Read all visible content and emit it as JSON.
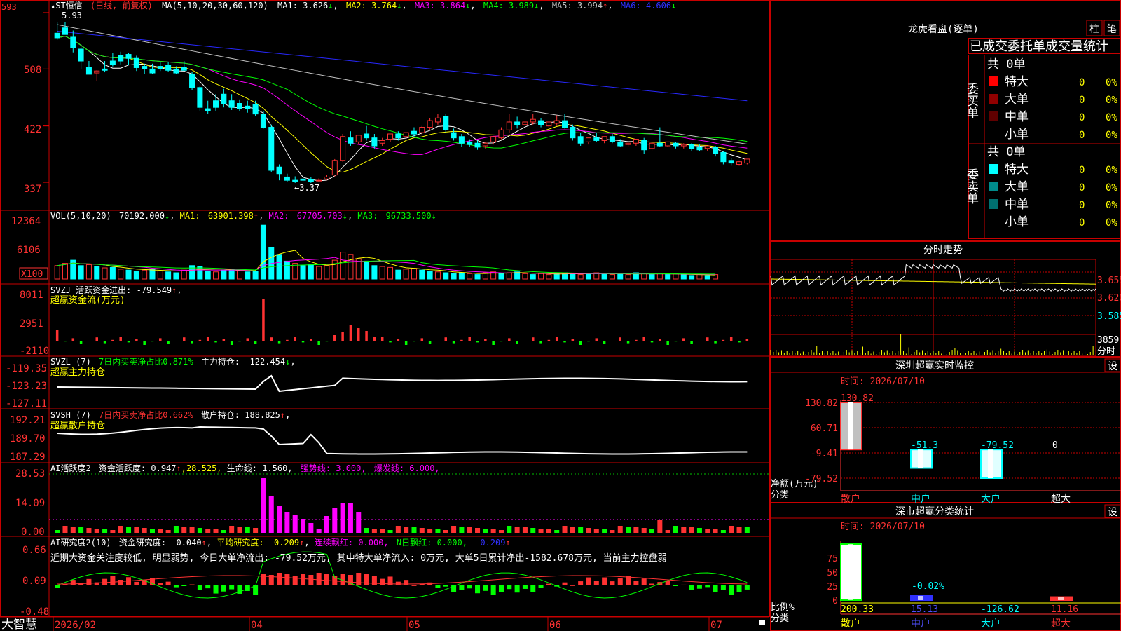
{
  "stock": {
    "name": "★ST恒信",
    "period": "(日线, 前复权)"
  },
  "colors": {
    "up": "#ff3232",
    "down": "#00ffff",
    "bg": "#000000",
    "border": "#ff0000",
    "ma5": "#ffffff",
    "ma10": "#ffff00",
    "ma20": "#ff00ff",
    "ma30": "#00ff00",
    "ma60": "#c0c0c0",
    "ma120": "#2828ff"
  },
  "price_panel": {
    "axis_labels": [
      "593",
      "508",
      "422",
      "337"
    ],
    "ma_legend": {
      "prefix": "MA(5,10,20,30,60,120)",
      "items": [
        {
          "label": "MA1: 3.626",
          "arrow": "↓"
        },
        {
          "label": "MA2: 3.764",
          "arrow": "↓"
        },
        {
          "label": "MA3: 3.864",
          "arrow": "↓"
        },
        {
          "label": "MA4: 3.989",
          "arrow": "↓"
        },
        {
          "label": "MA5: 3.994",
          "arrow": "↑"
        },
        {
          "label": "MA6: 4.606",
          "arrow": "↓"
        }
      ]
    },
    "high_marker": "5.93",
    "low_marker": "←3.37"
  },
  "vol_panel": {
    "axis_labels": [
      "12364",
      "6106",
      "X100"
    ],
    "legend": [
      {
        "label": "VOL(5,10,20)",
        "value": "70192.000",
        "arrow": "↓"
      },
      {
        "label": "MA1:",
        "value": "63901.398",
        "arrow": "↑"
      },
      {
        "label": "MA2:",
        "value": "67705.703",
        "arrow": "↓"
      },
      {
        "label": "MA3:",
        "value": "96733.500",
        "arrow": "↓"
      }
    ]
  },
  "svzj_panel": {
    "axis_labels": [
      "8011",
      "2951",
      "-2110"
    ],
    "line1": "SVZJ  活跃资金进出: -79.549",
    "line1_arrow": "↑",
    "line1_tail": ",",
    "line2": "超赢资金流(万元)"
  },
  "svzl_panel": {
    "axis_labels": [
      "-119.35",
      "-123.23",
      "-127.11"
    ],
    "name": "SVZL (7)",
    "ratio": "7日内买卖净占比0.871%",
    "hold": "主力持仓: -122.454",
    "hold_arrow": "↓",
    "tail": ",",
    "line2": "超赢主力持仓"
  },
  "svsh_panel": {
    "axis_labels": [
      "192.21",
      "189.70",
      "187.29"
    ],
    "name": "SVSH (7)",
    "ratio": "7日内买卖净占比0.662%",
    "hold": "散户持仓: 188.825",
    "hold_arrow": "↑",
    "tail": ",",
    "line2": "超赢散户持仓"
  },
  "ai1_panel": {
    "axis_labels": [
      "28.53",
      "14.09",
      "0.00"
    ],
    "name": "AI活跃度2",
    "v1": "资金活跃度: 0.947",
    "v1_arrow": "↑",
    "v2": ",28.525,",
    "v3": "生命线: 1.560,",
    "v4": "强势线: 3.000,",
    "v5": "爆发线: 6.000,"
  },
  "ai2_panel": {
    "axis_labels": [
      "0.66",
      "0.09",
      "-0.48"
    ],
    "name": "AI研究度2(10)",
    "v1": "资金研究度: -0.040",
    "v1_arrow": "↑",
    "v2": "平均研究度: -0.209",
    "v2_arrow": "↑",
    "v3": "连续飘红: 0.000,",
    "v4": "N日飘红: 0.000,",
    "v5": "-0.209",
    "v5_arrow": "↑",
    "comment": "近期大资金关注度较低, 明显弱势, 今日大单净流出: -79.52万元, 其中特大单净流入: 0万元, 大单5日累计净出-1582.678万元, 当前主力控盘弱"
  },
  "x_axis": {
    "labels": [
      "2026/02",
      "04",
      "05",
      "06",
      "07"
    ]
  },
  "logo": "大智慧",
  "dragon": {
    "title": "龙虎看盘(逐单)",
    "btn_chart": "柱",
    "btn_tick": "笔",
    "subtitle": "已成交委托单成交量统计",
    "buy_side": "委买单",
    "sell_side": "委卖单",
    "buy_total": "共 0单",
    "sell_total": "共 0单",
    "buy_rows": [
      {
        "label": "特大",
        "count": "0",
        "pct": "0%",
        "color": "#ff0000"
      },
      {
        "label": "大单",
        "count": "0",
        "pct": "0%",
        "color": "#900000"
      },
      {
        "label": "中单",
        "count": "0",
        "pct": "0%",
        "color": "#600000"
      },
      {
        "label": "小单",
        "count": "0",
        "pct": "0%",
        "color": "#000000"
      }
    ],
    "sell_rows": [
      {
        "label": "特大",
        "count": "0",
        "pct": "0%",
        "color": "#00ffff"
      },
      {
        "label": "大单",
        "count": "0",
        "pct": "0%",
        "color": "#008b8b"
      },
      {
        "label": "中单",
        "count": "0",
        "pct": "0%",
        "color": "#007070"
      },
      {
        "label": "小单",
        "count": "0",
        "pct": "0%",
        "color": "#000000"
      }
    ]
  },
  "intraday": {
    "title": "分时走势",
    "price_labels": [
      "3.655",
      "3.620",
      "3.585"
    ],
    "vol_label": "3859",
    "vol_unit": "分时"
  },
  "monitor": {
    "title": "深圳超赢实时监控",
    "btn": "设",
    "time": "时间: 2026/07/10",
    "y_labels": [
      "130.82",
      "60.71",
      "-9.41",
      "-79.52"
    ],
    "y_title": "净额(万元)",
    "x_title": "分类",
    "bars": [
      {
        "label": "散户",
        "value": 130.82,
        "text": "130.82"
      },
      {
        "label": "中户",
        "value": -51.3,
        "text": "-51.3"
      },
      {
        "label": "大户",
        "value": -79.52,
        "text": "-79.52"
      },
      {
        "label": "超大",
        "value": 0,
        "text": "0"
      }
    ]
  },
  "classify": {
    "title": "深市超赢分类统计",
    "btn": "设",
    "time": "时间: 2026/07/10",
    "y_labels": [
      "75",
      "50",
      "25",
      "0"
    ],
    "y_title": "比例%",
    "x_title": "分类",
    "top_note": "-0.02%",
    "bars": [
      {
        "label": "散户",
        "value": 200.33,
        "text": "200.33",
        "color": "#ffffff",
        "text_color": "#ffff00"
      },
      {
        "label": "中户",
        "value": 15.13,
        "text": "15.13",
        "color": "#3030ff",
        "text_color": "#5050ff"
      },
      {
        "label": "大户",
        "value": -126.62,
        "text": "-126.62",
        "color": "#00ffff",
        "text_color": "#00ffff"
      },
      {
        "label": "超大",
        "value": 11.16,
        "text": "11.16",
        "color": "#ff3232",
        "text_color": "#ff3232"
      }
    ]
  },
  "chart_data": {
    "type": "candlestick",
    "price_range": [
      337,
      593
    ],
    "ma120_from_to": [
      565,
      460
    ],
    "ma60_from_to": [
      575,
      395
    ],
    "notes": "Daily price series (x100 units) from 2026/02 to 07; values approximated from chart.",
    "ohlc": [
      [
        562,
        578,
        555,
        552
      ],
      [
        570,
        579,
        560,
        565
      ],
      [
        556,
        566,
        540,
        533
      ],
      [
        538,
        545,
        520,
        508
      ],
      [
        510,
        520,
        500,
        505
      ],
      [
        502,
        506,
        505,
        490
      ],
      [
        508,
        520,
        506,
        503
      ],
      [
        520,
        532,
        515,
        512
      ],
      [
        528,
        534,
        520,
        515
      ],
      [
        530,
        532,
        524,
        514
      ],
      [
        524,
        528,
        510,
        505
      ],
      [
        512,
        516,
        508,
        500
      ],
      [
        508,
        516,
        502,
        500
      ],
      [
        512,
        518,
        508,
        505
      ],
      [
        514,
        518,
        506,
        504
      ],
      [
        508,
        512,
        502,
        500
      ],
      [
        510,
        520,
        506,
        505
      ],
      [
        500,
        504,
        480,
        476
      ],
      [
        480,
        482,
        450,
        445
      ],
      [
        448,
        460,
        445,
        440
      ],
      [
        460,
        470,
        450,
        445
      ],
      [
        470,
        478,
        455,
        450
      ],
      [
        460,
        470,
        450,
        446
      ],
      [
        456,
        462,
        448,
        444
      ],
      [
        452,
        460,
        448,
        442
      ],
      [
        455,
        460,
        440,
        437
      ],
      [
        440,
        444,
        420,
        418
      ],
      [
        420,
        424,
        355,
        352
      ],
      [
        360,
        364,
        350,
        340
      ],
      [
        345,
        350,
        340,
        337
      ],
      [
        340,
        346,
        338,
        336
      ],
      [
        342,
        346,
        340,
        337
      ],
      [
        341,
        345,
        338,
        336
      ],
      [
        339,
        343,
        340,
        337
      ],
      [
        342,
        348,
        345,
        340
      ],
      [
        348,
        372,
        370,
        346
      ],
      [
        370,
        410,
        406,
        368
      ],
      [
        404,
        414,
        396,
        392
      ],
      [
        398,
        404,
        408,
        395
      ],
      [
        410,
        422,
        404,
        400
      ],
      [
        404,
        410,
        392,
        388
      ],
      [
        396,
        404,
        400,
        392
      ],
      [
        402,
        406,
        410,
        398
      ],
      [
        410,
        414,
        404,
        400
      ],
      [
        406,
        410,
        412,
        402
      ],
      [
        414,
        420,
        410,
        406
      ],
      [
        412,
        422,
        420,
        408
      ],
      [
        420,
        434,
        430,
        416
      ],
      [
        428,
        440,
        434,
        424
      ],
      [
        436,
        440,
        416,
        412
      ],
      [
        412,
        418,
        404,
        400
      ],
      [
        406,
        410,
        396,
        390
      ],
      [
        398,
        402,
        394,
        390
      ],
      [
        396,
        400,
        390,
        386
      ],
      [
        392,
        398,
        396,
        388
      ],
      [
        398,
        402,
        406,
        394
      ],
      [
        404,
        420,
        416,
        402
      ],
      [
        416,
        440,
        428,
        412
      ],
      [
        428,
        436,
        424,
        418
      ],
      [
        424,
        428,
        428,
        420
      ],
      [
        428,
        440,
        432,
        424
      ],
      [
        430,
        434,
        424,
        420
      ],
      [
        422,
        426,
        428,
        418
      ],
      [
        426,
        438,
        430,
        422
      ],
      [
        430,
        440,
        420,
        418
      ],
      [
        420,
        424,
        404,
        400
      ],
      [
        406,
        412,
        396,
        392
      ],
      [
        398,
        402,
        404,
        394
      ],
      [
        404,
        412,
        400,
        398
      ],
      [
        400,
        404,
        406,
        396
      ],
      [
        406,
        410,
        398,
        396
      ],
      [
        398,
        402,
        392,
        390
      ],
      [
        394,
        398,
        396,
        390
      ],
      [
        396,
        400,
        402,
        392
      ],
      [
        400,
        404,
        386,
        380
      ],
      [
        388,
        392,
        396,
        384
      ],
      [
        396,
        420,
        392,
        390
      ],
      [
        392,
        396,
        398,
        390
      ],
      [
        396,
        398,
        392,
        388
      ],
      [
        392,
        396,
        394,
        388
      ],
      [
        394,
        396,
        388,
        384
      ],
      [
        390,
        394,
        386,
        384
      ],
      [
        388,
        390,
        392,
        384
      ],
      [
        390,
        392,
        380,
        376
      ],
      [
        382,
        384,
        368,
        364
      ],
      [
        370,
        374,
        366,
        362
      ],
      [
        364,
        370,
        368,
        362
      ],
      [
        366,
        370,
        372,
        364
      ]
    ],
    "volume": [
      [
        30,
        1
      ],
      [
        35,
        1
      ],
      [
        42,
        0
      ],
      [
        30,
        0
      ],
      [
        32,
        1
      ],
      [
        28,
        0
      ],
      [
        25,
        1
      ],
      [
        26,
        0
      ],
      [
        22,
        1
      ],
      [
        20,
        0
      ],
      [
        18,
        0
      ],
      [
        20,
        1
      ],
      [
        22,
        0
      ],
      [
        18,
        1
      ],
      [
        16,
        0
      ],
      [
        14,
        0
      ],
      [
        20,
        1
      ],
      [
        30,
        0
      ],
      [
        28,
        0
      ],
      [
        18,
        0
      ],
      [
        16,
        1
      ],
      [
        20,
        0
      ],
      [
        22,
        0
      ],
      [
        18,
        1
      ],
      [
        16,
        0
      ],
      [
        18,
        0
      ],
      [
        120,
        0
      ],
      [
        70,
        0
      ],
      [
        55,
        0
      ],
      [
        40,
        0
      ],
      [
        35,
        1
      ],
      [
        30,
        0
      ],
      [
        32,
        0
      ],
      [
        28,
        1
      ],
      [
        30,
        1
      ],
      [
        42,
        1
      ],
      [
        60,
        1
      ],
      [
        55,
        1
      ],
      [
        45,
        1
      ],
      [
        40,
        0
      ],
      [
        30,
        0
      ],
      [
        28,
        1
      ],
      [
        26,
        1
      ],
      [
        20,
        0
      ],
      [
        22,
        1
      ],
      [
        24,
        1
      ],
      [
        20,
        0
      ],
      [
        18,
        0
      ],
      [
        16,
        1
      ],
      [
        14,
        0
      ],
      [
        12,
        0
      ],
      [
        14,
        0
      ],
      [
        12,
        1
      ],
      [
        10,
        0
      ],
      [
        14,
        1
      ],
      [
        16,
        1
      ],
      [
        12,
        0
      ],
      [
        14,
        1
      ],
      [
        16,
        0
      ],
      [
        12,
        1
      ],
      [
        10,
        0
      ],
      [
        12,
        1
      ],
      [
        10,
        1
      ],
      [
        12,
        0
      ],
      [
        14,
        0
      ],
      [
        12,
        0
      ],
      [
        10,
        1
      ],
      [
        12,
        0
      ],
      [
        14,
        1
      ],
      [
        12,
        0
      ],
      [
        10,
        1
      ],
      [
        12,
        0
      ],
      [
        10,
        1
      ],
      [
        14,
        0
      ],
      [
        12,
        1
      ],
      [
        10,
        0
      ],
      [
        12,
        1
      ],
      [
        10,
        0
      ],
      [
        12,
        1
      ],
      [
        10,
        0
      ],
      [
        8,
        0
      ],
      [
        10,
        1
      ],
      [
        8,
        0
      ],
      [
        10,
        1
      ]
    ]
  }
}
